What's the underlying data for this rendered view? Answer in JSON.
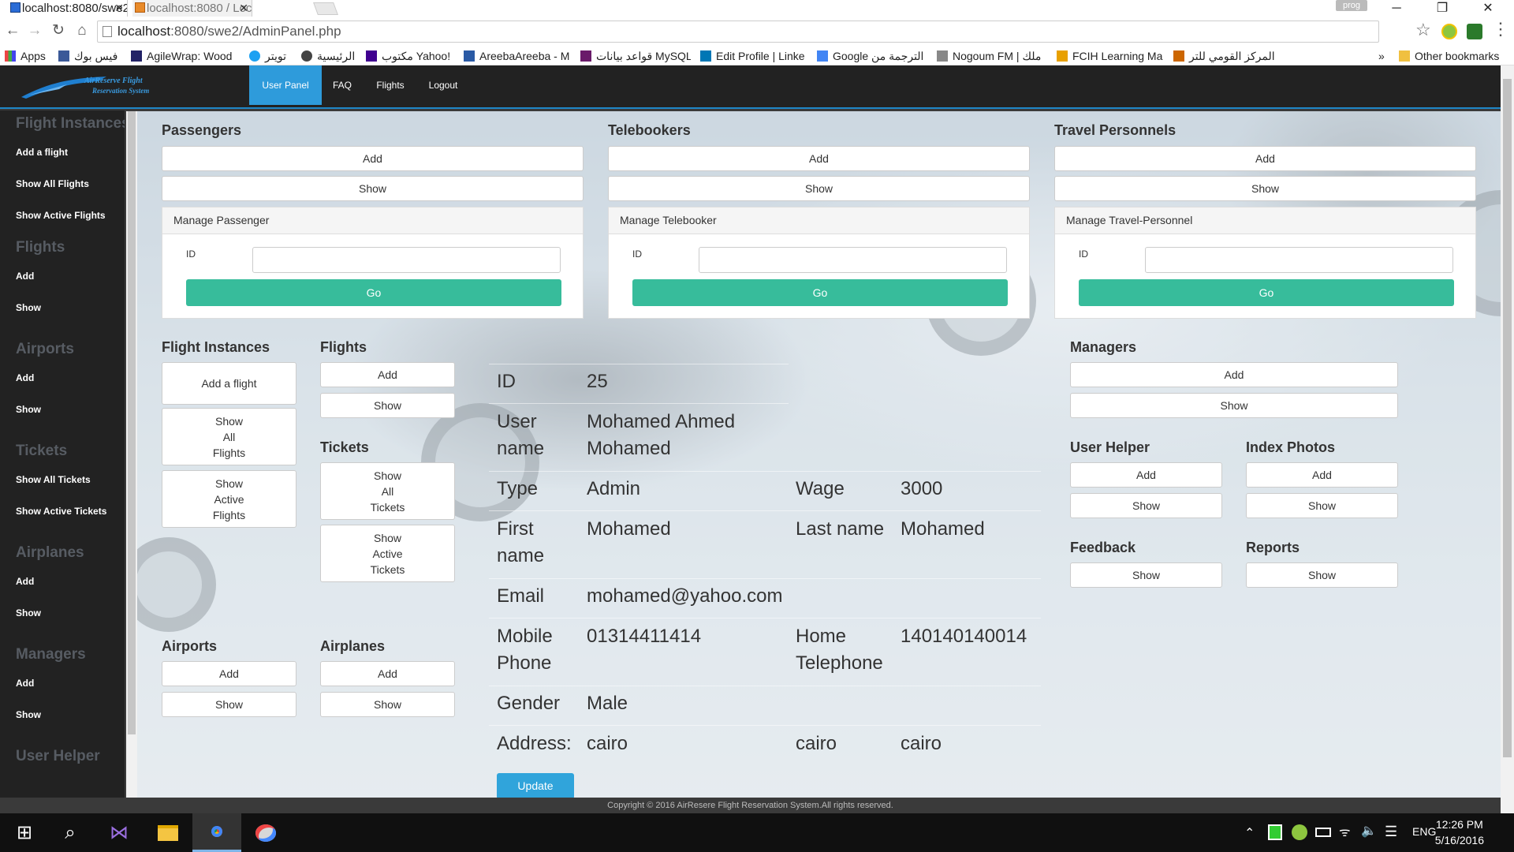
{
  "browser": {
    "tabs": [
      {
        "title": "localhost:8080/swe2/",
        "active": true
      },
      {
        "title": "localhost:8080 / Loc",
        "active": false
      }
    ],
    "profile": "prog",
    "url_host": "localhost",
    "url_rest": ":8080/swe2/AdminPanel.php",
    "bookmarks": [
      "Apps",
      "فيس بوك",
      "AgileWrap: Wood",
      "تويتر",
      "الرئيسية",
      "مكتوب Yahoo!",
      "AreebaAreeba - M",
      "قواعد بيانات MySQL",
      "Edit Profile | Linke",
      "Google الترجمة من",
      "Nogoum FM | ملك",
      "FCIH Learning Ma",
      "المركز القومي للتر"
    ],
    "bookmarks_more": "»",
    "other_bookmarks": "Other bookmarks"
  },
  "site": {
    "logo_line1": "AirReserve Flight",
    "logo_line2": "Reservation System",
    "nav": [
      "User Panel",
      "FAQ",
      "Flights",
      "Logout"
    ]
  },
  "sidebar": {
    "sections": [
      {
        "title": "Flight Instances",
        "items": [
          "Add a flight",
          "Show All Flights",
          "Show Active Flights"
        ]
      },
      {
        "title": "Flights",
        "items": [
          "Add",
          "Show"
        ]
      },
      {
        "title": "Airports",
        "items": [
          "Add",
          "Show"
        ]
      },
      {
        "title": "Tickets",
        "items": [
          "Show All Tickets",
          "Show Active Tickets"
        ]
      },
      {
        "title": "Airplanes",
        "items": [
          "Add",
          "Show"
        ]
      },
      {
        "title": "Managers",
        "items": [
          "Add",
          "Show"
        ]
      },
      {
        "title": "User Helper",
        "items": []
      }
    ]
  },
  "top_groups": [
    {
      "title": "Passengers",
      "add": "Add",
      "show": "Show",
      "panel_title": "Manage Passenger",
      "id_label": "ID",
      "go": "Go"
    },
    {
      "title": "Telebookers",
      "add": "Add",
      "show": "Show",
      "panel_title": "Manage Telebooker",
      "id_label": "ID",
      "go": "Go"
    },
    {
      "title": "Travel Personnels",
      "add": "Add",
      "show": "Show",
      "panel_title": "Manage Travel-Personnel",
      "id_label": "ID",
      "go": "Go"
    }
  ],
  "left_groups": {
    "flight_instances": {
      "title": "Flight Instances",
      "add": "Add a flight",
      "show_all": "Show All Flights",
      "show_active": "Show Active Flights"
    },
    "flights": {
      "title": "Flights",
      "add": "Add",
      "show": "Show"
    },
    "tickets": {
      "title": "Tickets",
      "show_all": "Show All Tickets",
      "show_active": "Show Active Tickets"
    },
    "airports": {
      "title": "Airports",
      "add": "Add",
      "show": "Show"
    },
    "airplanes": {
      "title": "Airplanes",
      "add": "Add",
      "show": "Show"
    }
  },
  "profile": {
    "id_label": "ID",
    "id": "25",
    "username_label": "User name",
    "username": "Mohamed Ahmed Mohamed",
    "type_label": "Type",
    "type": "Admin",
    "wage_label": "Wage",
    "wage": "3000",
    "firstname_label": "First name",
    "firstname": "Mohamed",
    "lastname_label": "Last name",
    "lastname": "Mohamed",
    "email_label": "Email",
    "email": "mohamed@yahoo.com",
    "mobile_label": "Mobile Phone",
    "mobile": "01314411414",
    "home_label": "Home Telephone",
    "home": "140140140014",
    "gender_label": "Gender",
    "gender": "Male",
    "address_label": "Address:",
    "address1": "cairo",
    "address2": "cairo",
    "address3": "cairo",
    "update": "Update"
  },
  "right_groups": {
    "managers": {
      "title": "Managers",
      "add": "Add",
      "show": "Show"
    },
    "user_helper": {
      "title": "User Helper",
      "add": "Add",
      "show": "Show"
    },
    "index_photos": {
      "title": "Index Photos",
      "add": "Add",
      "show": "Show"
    },
    "feedback": {
      "title": "Feedback",
      "show": "Show"
    },
    "reports": {
      "title": "Reports",
      "show": "Show"
    }
  },
  "footer": "Copyright © 2016 AirResere Flight Reservation System.All rights reserved.",
  "taskbar": {
    "time": "12:26 PM",
    "date": "5/16/2016",
    "lang": "ENG"
  },
  "colors": {
    "accent": "#2e9bdb",
    "go": "#37bc9b",
    "navbar": "#222222"
  }
}
